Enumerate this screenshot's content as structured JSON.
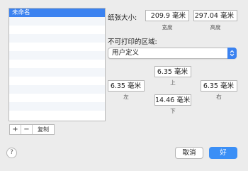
{
  "presets": {
    "items": [
      {
        "label": "未命名",
        "selected": true
      },
      {
        "label": "",
        "selected": false
      },
      {
        "label": "",
        "selected": false
      },
      {
        "label": "",
        "selected": false
      },
      {
        "label": "",
        "selected": false
      },
      {
        "label": "",
        "selected": false
      },
      {
        "label": "",
        "selected": false
      },
      {
        "label": "",
        "selected": false
      },
      {
        "label": "",
        "selected": false
      },
      {
        "label": "",
        "selected": false
      },
      {
        "label": "",
        "selected": false
      },
      {
        "label": "",
        "selected": false
      },
      {
        "label": "",
        "selected": false
      }
    ],
    "add_label": "+",
    "remove_label": "−",
    "duplicate_label": "复制"
  },
  "paper_size": {
    "label": "纸张大小:",
    "width_value": "209.9 毫米",
    "width_caption": "宽度",
    "height_value": "297.04 毫米",
    "height_caption": "高度"
  },
  "non_printable": {
    "label": "不可打印的区域:",
    "selected_option": "用户定义",
    "top_value": "6.35 毫米",
    "top_caption": "上",
    "left_value": "6.35 毫米",
    "left_caption": "左",
    "right_value": "6.35 毫米",
    "right_caption": "右",
    "bottom_value": "14.46 毫米",
    "bottom_caption": "下"
  },
  "footer": {
    "help_label": "?",
    "cancel_label": "取消",
    "ok_label": "好"
  },
  "colors": {
    "accent": "#3b82f0",
    "background": "#ececec"
  }
}
